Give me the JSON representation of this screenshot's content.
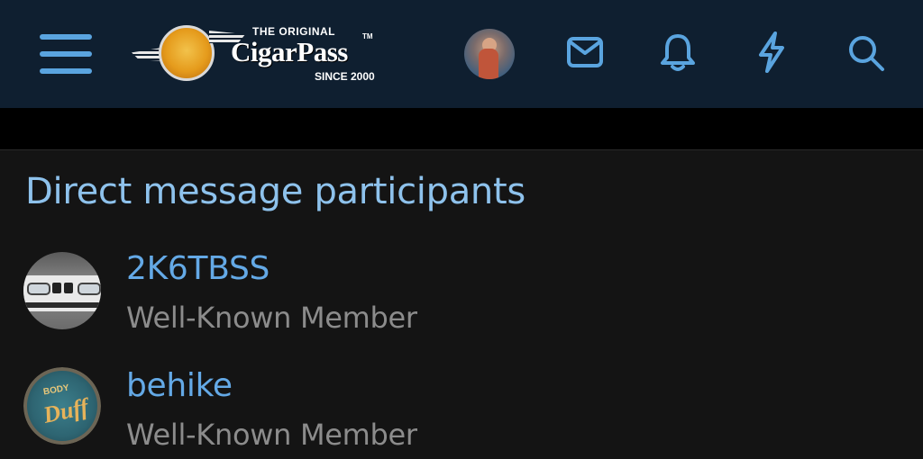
{
  "header": {
    "menu_icon": "hamburger-menu-icon",
    "logo": {
      "top_text": "THE ORIGINAL",
      "main_text": "CigarPass",
      "tm": "TM",
      "since_text": "SINCE 2000"
    },
    "icons": [
      "user-avatar",
      "mail-icon",
      "bell-icon",
      "lightning-icon",
      "search-icon"
    ],
    "icon_color": "#5aa4df",
    "background": "#0f1f30"
  },
  "section": {
    "title": "Direct message participants"
  },
  "participants": [
    {
      "name": "2K6TBSS",
      "role": "Well-Known Member",
      "avatar": "car-avatar"
    },
    {
      "name": "behike",
      "role": "Well-Known Member",
      "avatar": "duff-avatar",
      "avatar_text_top": "BODY",
      "avatar_text_main": "Duff"
    }
  ],
  "colors": {
    "page_background": "#141414",
    "title": "#8ec2ec",
    "link": "#64a9e6",
    "muted": "#8c8c8c"
  }
}
